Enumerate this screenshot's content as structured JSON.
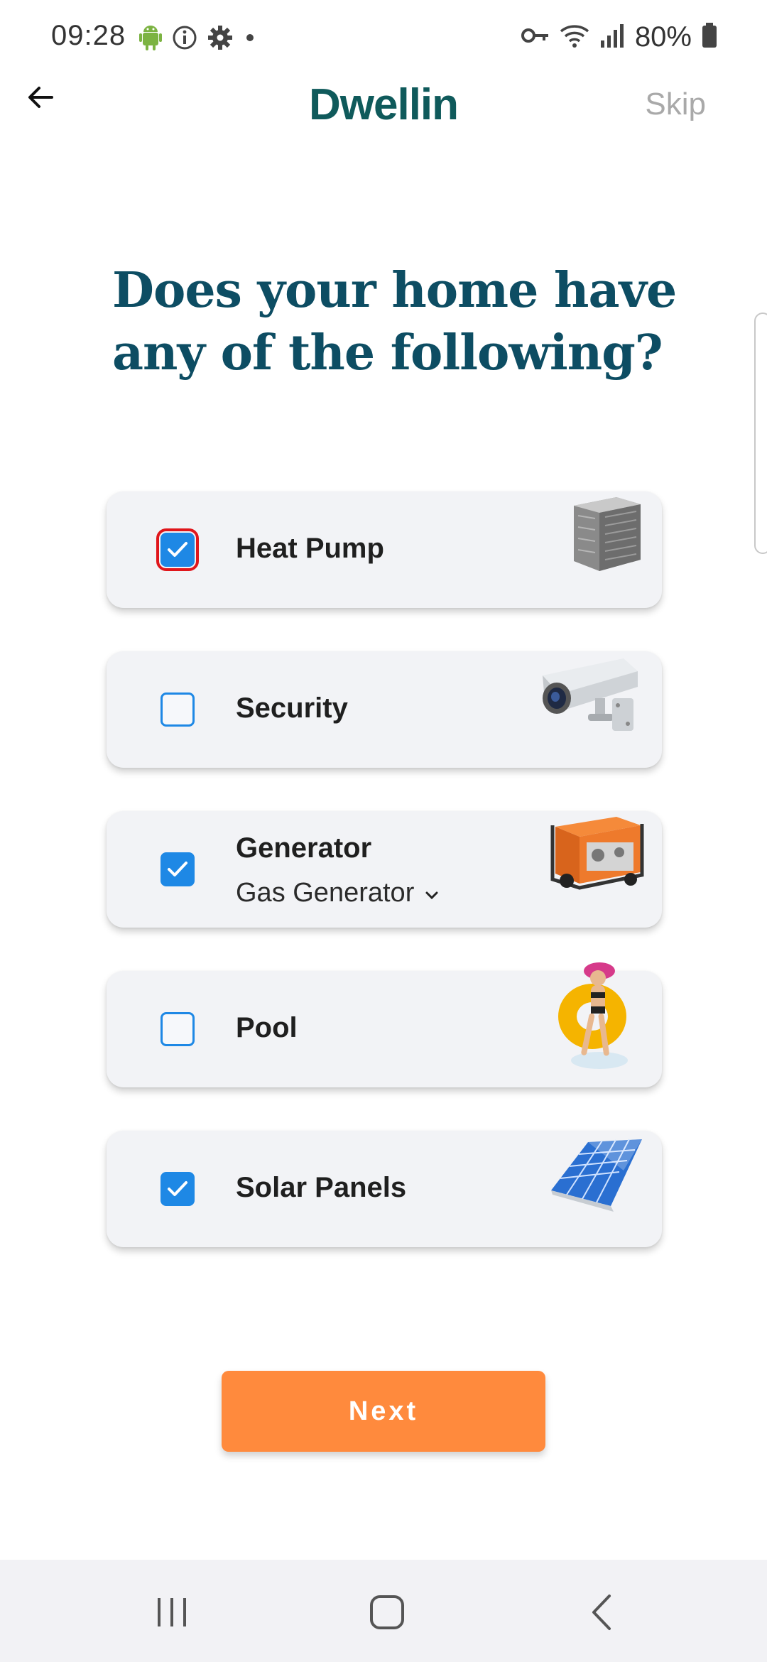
{
  "status_bar": {
    "time": "09:28",
    "battery_percent": "80%",
    "icons_left": [
      "android-icon",
      "info-icon",
      "settings-icon",
      "dot-icon"
    ],
    "icons_right": [
      "vpn-key-icon",
      "wifi-icon",
      "signal-icon",
      "battery-icon"
    ]
  },
  "header": {
    "brand": "Dwellin",
    "skip_label": "Skip"
  },
  "heading": {
    "line1": "Does your home have",
    "line2": "any of the following?"
  },
  "items": [
    {
      "label": "Heat Pump",
      "checked": true,
      "focused": true,
      "image": "heat-pump-image"
    },
    {
      "label": "Security",
      "checked": false,
      "image": "security-camera-image"
    },
    {
      "label": "Generator",
      "checked": true,
      "sublabel": "Gas Generator",
      "image": "generator-image"
    },
    {
      "label": "Pool",
      "checked": false,
      "image": "pool-image"
    },
    {
      "label": "Solar Panels",
      "checked": true,
      "image": "solar-panel-image"
    }
  ],
  "next_label": "Next",
  "colors": {
    "brand": "#0f5a5b",
    "heading": "#0d4d63",
    "checkbox": "#1e88e5",
    "next_button": "#ff8a3d",
    "focus_outline": "#e0161b"
  }
}
